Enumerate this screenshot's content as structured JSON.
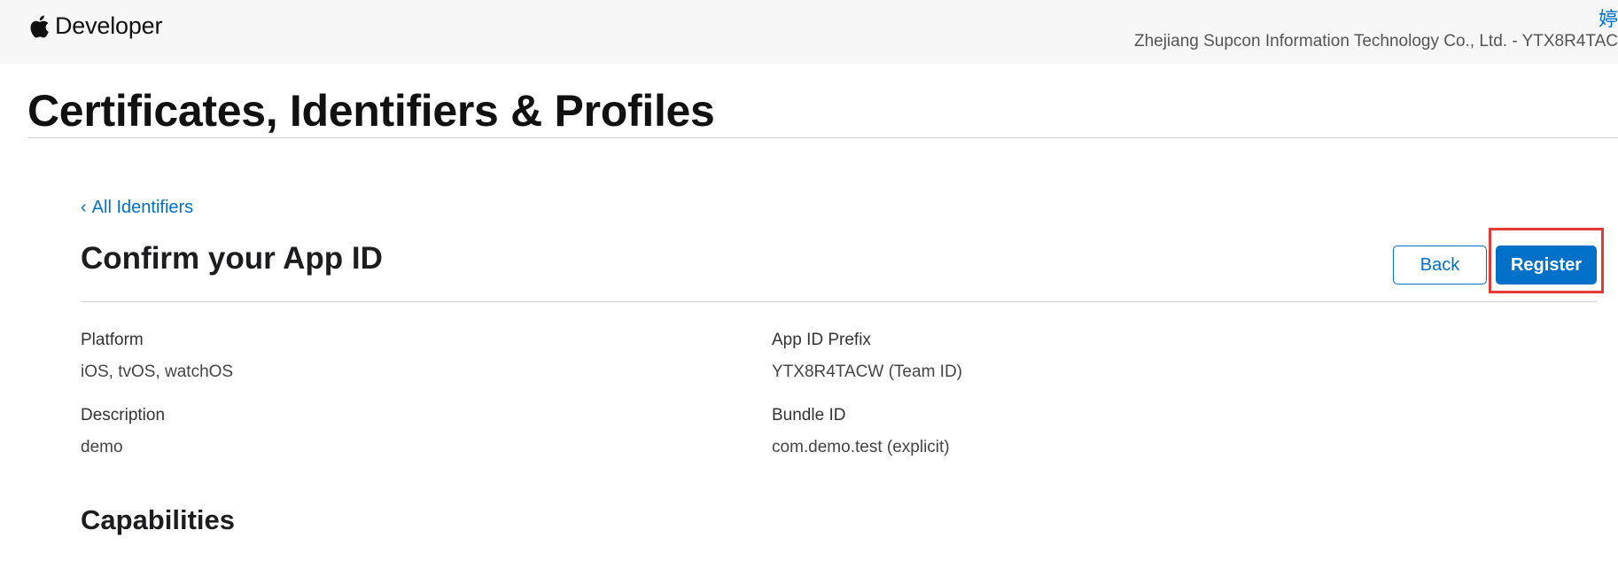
{
  "header": {
    "brand_text": "Developer",
    "logo_icon": "apple-logo-icon",
    "user_initial": "婷",
    "team_name": "Zhejiang Supcon Information Technology Co., Ltd. - YTX8R4TAC"
  },
  "page": {
    "title": "Certificates, Identifiers & Profiles"
  },
  "content": {
    "back_link_chevron": "‹",
    "back_link_label": "All Identifiers",
    "section_title": "Confirm your App ID",
    "buttons": {
      "back_label": "Back",
      "register_label": "Register"
    },
    "fields": {
      "platform_label": "Platform",
      "platform_value": "iOS, tvOS, watchOS",
      "app_id_prefix_label": "App ID Prefix",
      "app_id_prefix_value": "YTX8R4TACW (Team ID)",
      "description_label": "Description",
      "description_value": "demo",
      "bundle_id_label": "Bundle ID",
      "bundle_id_value": "com.demo.test (explicit)"
    },
    "capabilities_title": "Capabilities"
  },
  "colors": {
    "accent": "#0070c9",
    "highlight": "#e53935",
    "topbar_bg": "#f7f7f7"
  }
}
